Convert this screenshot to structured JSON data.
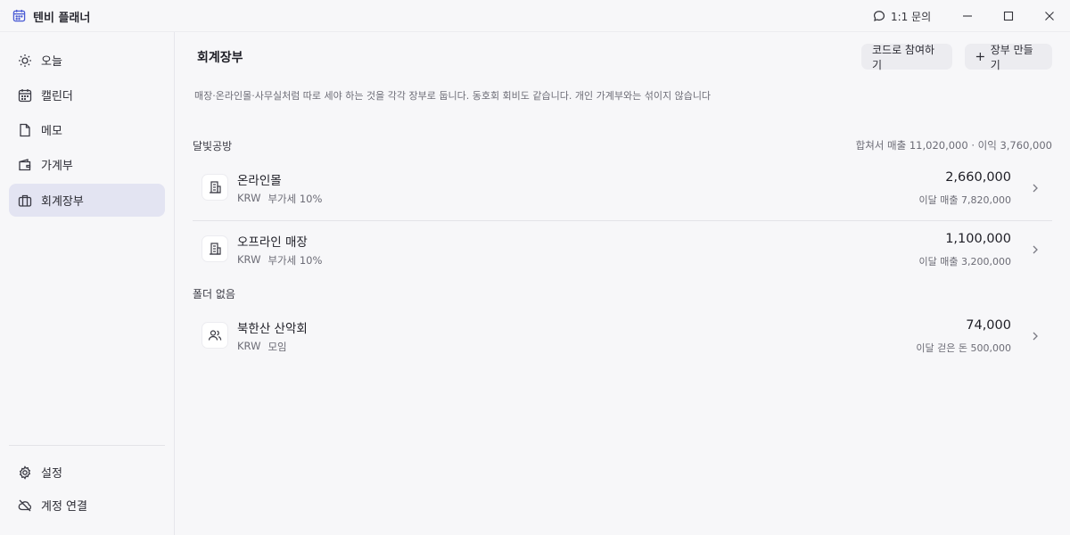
{
  "app": {
    "title": "텐비 플래너"
  },
  "titlebar": {
    "inquiry_label": "1:1 문의"
  },
  "sidebar": {
    "items": [
      {
        "label": "오늘",
        "icon": "sun-icon"
      },
      {
        "label": "캘린더",
        "icon": "calendar-icon"
      },
      {
        "label": "메모",
        "icon": "note-icon"
      },
      {
        "label": "가계부",
        "icon": "wallet-icon"
      },
      {
        "label": "회계장부",
        "icon": "briefcase-icon",
        "active": true
      }
    ],
    "bottom": [
      {
        "label": "설정",
        "icon": "gear-icon"
      },
      {
        "label": "계정 연결",
        "icon": "cloud-off-icon"
      }
    ]
  },
  "main": {
    "title": "회계장부",
    "join_button": "코드로 참여하기",
    "new_button": "장부 만들기",
    "description": "매장·온라인몰·사무실처럼 따로 세야 하는 것을 각각 장부로 둡니다. 동호회 회비도 같습니다. 개인 가계부와는 섞이지 않습니다",
    "groups": [
      {
        "label": "달빛공방",
        "summary": "합쳐서 매출 11,020,000 · 이익 3,760,000",
        "ledgers": [
          {
            "name": "온라인몰",
            "currency": "KRW",
            "tag": "부가세 10%",
            "amount": "2,660,000",
            "sub": "이달 매출 7,820,000",
            "icon": "building-icon"
          },
          {
            "name": "오프라인 매장",
            "currency": "KRW",
            "tag": "부가세 10%",
            "amount": "1,100,000",
            "sub": "이달 매출 3,200,000",
            "icon": "building-icon"
          }
        ]
      },
      {
        "label": "폴더 없음",
        "summary": "",
        "ledgers": [
          {
            "name": "북한산 산악회",
            "currency": "KRW",
            "tag": "모임",
            "amount": "74,000",
            "sub": "이달 걷은 돈 500,000",
            "icon": "users-icon"
          }
        ]
      }
    ]
  },
  "colors": {
    "accent": "#4a5bd4",
    "active_bg": "#e3e4f2",
    "background": "#f7f7f9"
  }
}
